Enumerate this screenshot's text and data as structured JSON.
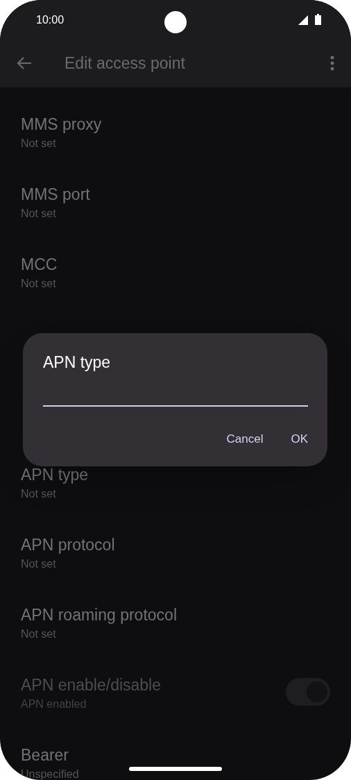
{
  "status_bar": {
    "time": "10:00"
  },
  "app_bar": {
    "title": "Edit access point"
  },
  "rows": [
    {
      "kind": "text",
      "title": "MMS proxy",
      "summary": "Not set"
    },
    {
      "kind": "text",
      "title": "MMS port",
      "summary": "Not set"
    },
    {
      "kind": "text",
      "title": "MCC",
      "summary": "Not set"
    },
    {
      "kind": "hidden"
    },
    {
      "kind": "hidden"
    },
    {
      "kind": "text",
      "title": "APN type",
      "summary": "Not set"
    },
    {
      "kind": "text",
      "title": "APN protocol",
      "summary": "Not set"
    },
    {
      "kind": "text",
      "title": "APN roaming protocol",
      "summary": "Not set"
    },
    {
      "kind": "switch",
      "title": "APN enable/disable",
      "summary": "APN enabled",
      "disabled": true,
      "on": true
    },
    {
      "kind": "text",
      "title": "Bearer",
      "summary": "Unspecified"
    }
  ],
  "dialog": {
    "title": "APN type",
    "buttons": [
      "Cancel",
      "OK"
    ]
  }
}
